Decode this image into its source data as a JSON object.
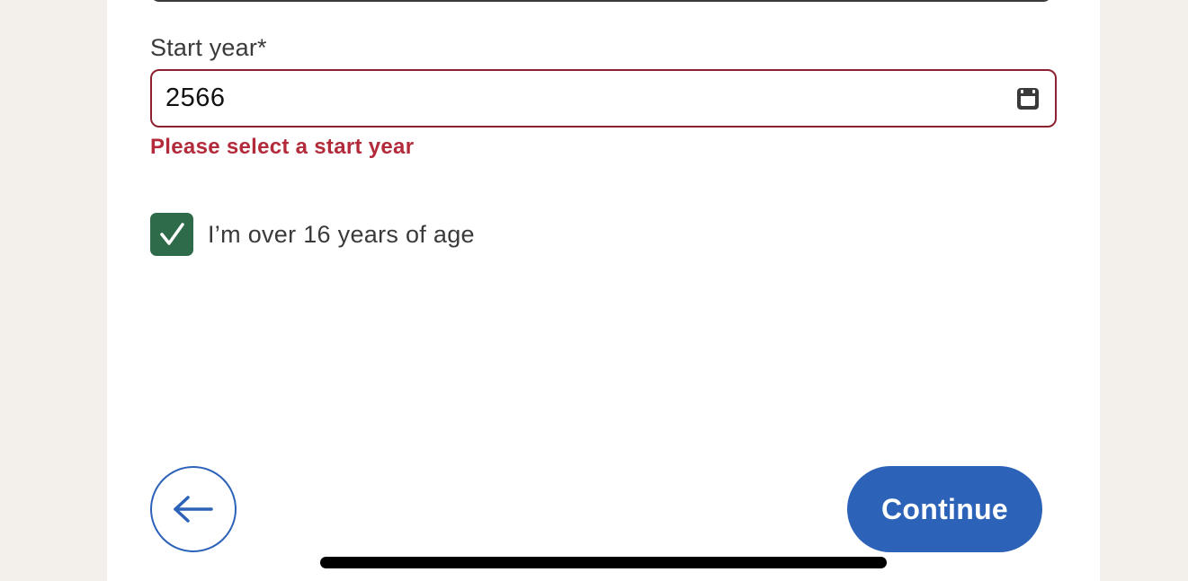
{
  "form": {
    "start_year": {
      "label": "Start year*",
      "value": "2566",
      "error": "Please select a start year",
      "icon": "calendar-icon"
    },
    "age_confirmation": {
      "label": "I’m over 16 years of age",
      "checked": true
    }
  },
  "actions": {
    "back_icon": "arrow-left-icon",
    "continue_label": "Continue"
  },
  "colors": {
    "background": "#f3f0eb",
    "card": "#ffffff",
    "error": "#b32a3a",
    "error_border": "#8c2230",
    "checkbox": "#2e6b4b",
    "primary": "#2c62b8",
    "text": "#3a3a3a"
  }
}
